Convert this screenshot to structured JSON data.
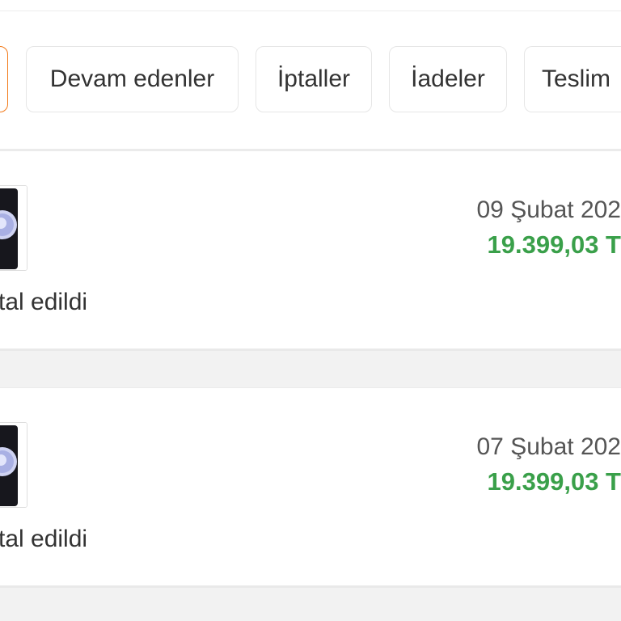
{
  "tabs": [
    {
      "label": "",
      "active": true
    },
    {
      "label": "Devam edenler",
      "active": false
    },
    {
      "label": "İptaller",
      "active": false
    },
    {
      "label": "İadeler",
      "active": false
    },
    {
      "label": "Teslim",
      "active": false
    }
  ],
  "orders": [
    {
      "date": "09 Şubat 202",
      "price": "19.399,03 T",
      "status": "tal edildi",
      "product_icon": "phone-icon"
    },
    {
      "date": "07 Şubat 202",
      "price": "19.399,03 T",
      "status": "tal edildi",
      "product_icon": "phone-icon"
    }
  ],
  "colors": {
    "accent": "#f27a1a",
    "price": "#3aa04a",
    "background": "#f2f2f2"
  }
}
